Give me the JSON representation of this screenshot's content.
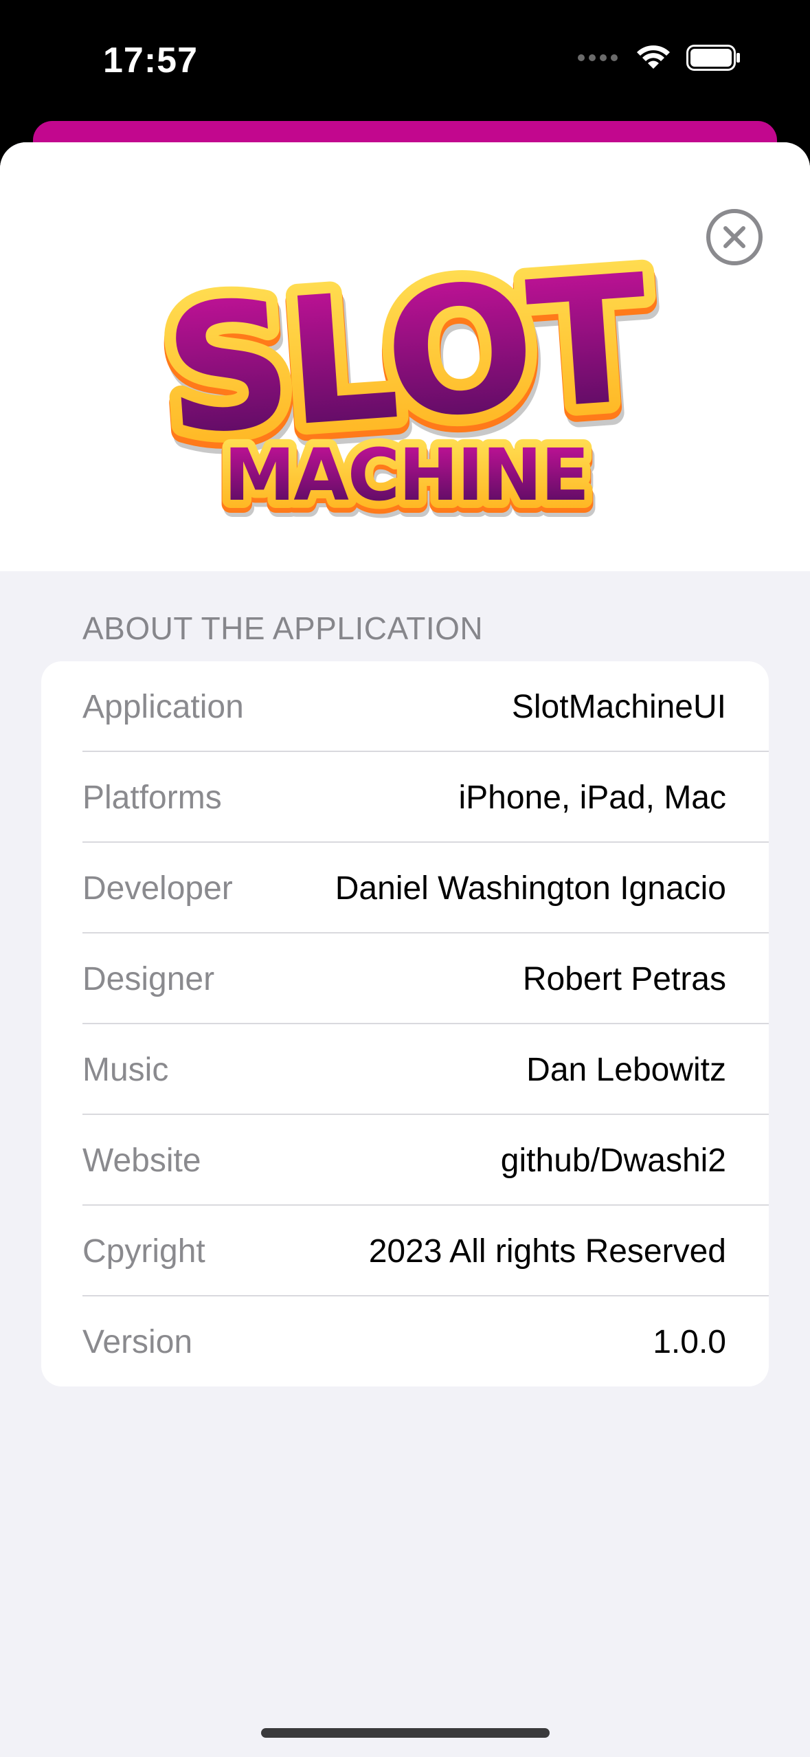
{
  "status_bar": {
    "time": "17:57",
    "icons": [
      "signal-dots-icon",
      "wifi-icon",
      "battery-icon"
    ]
  },
  "header": {
    "logo_line1": "SLOT",
    "logo_line2": "MACHINE",
    "close_icon": "xmark-circle-icon"
  },
  "about": {
    "section_title": "ABOUT THE APPLICATION",
    "rows": [
      {
        "label": "Application",
        "value": "SlotMachineUI"
      },
      {
        "label": "Platforms",
        "value": "iPhone, iPad, Mac"
      },
      {
        "label": "Developer",
        "value": "Daniel Washington Ignacio"
      },
      {
        "label": "Designer",
        "value": "Robert Petras"
      },
      {
        "label": "Music",
        "value": "Dan Lebowitz"
      },
      {
        "label": "Website",
        "value": "github/Dwashi2"
      },
      {
        "label": "Cpyright",
        "value": "2023 All rights Reserved"
      },
      {
        "label": "Version",
        "value": "1.0.0"
      }
    ]
  },
  "colors": {
    "accent": "#c2078e",
    "logo_purple": "#8a0a7d",
    "logo_gold": "#ffc83a"
  }
}
